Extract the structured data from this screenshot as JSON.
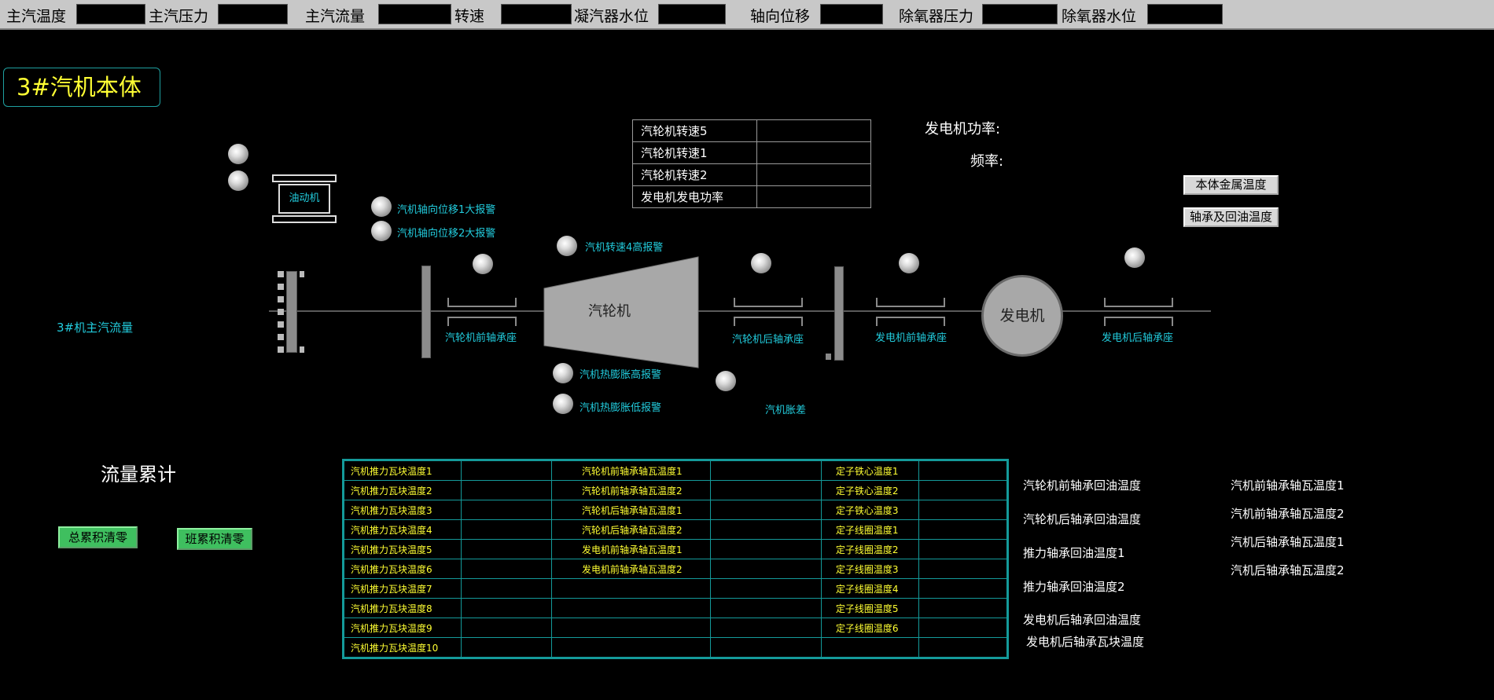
{
  "header": {
    "labels": [
      "主汽温度",
      "主汽压力",
      "主汽流量",
      "转速",
      "凝汽器水位",
      "轴向位移",
      "除氧器压力",
      "除氧器水位"
    ]
  },
  "page_title": "3#汽机本体",
  "equipment": {
    "oil_pump": "油动机",
    "turbine": "汽轮机",
    "generator": "发电机",
    "main_steam_flow": "3#机主汽流量",
    "bearings": [
      "汽轮机前轴承座",
      "汽轮机后轴承座",
      "发电机前轴承座",
      "发电机后轴承座"
    ],
    "differential_expansion": "汽机胀差"
  },
  "alarms": {
    "axial1": "汽机轴向位移1大报警",
    "axial2": "汽机轴向位移2大报警",
    "speed4": "汽机转速4高报警",
    "exp_high": "汽机热膨胀高报警",
    "exp_low": "汽机热膨胀低报警"
  },
  "speed_table": [
    {
      "label": "汽轮机转速5",
      "value": ""
    },
    {
      "label": "汽轮机转速1",
      "value": ""
    },
    {
      "label": "汽轮机转速2",
      "value": ""
    },
    {
      "label": "发电机发电功率",
      "value": ""
    }
  ],
  "generator_power_label": "发电机功率:",
  "frequency_label": "频率:",
  "buttons": {
    "metal_temp": "本体金属温度",
    "bearing_oil_temp": "轴承及回油温度",
    "total_reset": "总累积清零",
    "shift_reset": "班累积清零"
  },
  "flow_total_label": "流量累计",
  "temp_table": {
    "col1": [
      "汽机推力瓦块温度1",
      "汽机推力瓦块温度2",
      "汽机推力瓦块温度3",
      "汽机推力瓦块温度4",
      "汽机推力瓦块温度5",
      "汽机推力瓦块温度6",
      "汽机推力瓦块温度7",
      "汽机推力瓦块温度8",
      "汽机推力瓦块温度9",
      "汽机推力瓦块温度10"
    ],
    "col2": [
      "汽轮机前轴承轴瓦温度1",
      "汽轮机前轴承轴瓦温度2",
      "汽轮机后轴承轴瓦温度1",
      "汽轮机后轴承轴瓦温度2",
      "发电机前轴承轴瓦温度1",
      "发电机前轴承轴瓦温度2",
      "",
      "",
      "",
      ""
    ],
    "col3": [
      "定子铁心温度1",
      "定子铁心温度2",
      "定子铁心温度3",
      "定子线圈温度1",
      "定子线圈温度2",
      "定子线圈温度3",
      "定子线圈温度4",
      "定子线圈温度5",
      "定子线圈温度6",
      ""
    ]
  },
  "right_labels_1": [
    "汽轮机前轴承回油温度",
    "汽轮机后轴承回油温度",
    "推力轴承回油温度1",
    "推力轴承回油温度2",
    "发电机后轴承回油温度",
    "发电机后轴承瓦块温度"
  ],
  "right_labels_2": [
    "汽机前轴承轴瓦温度1",
    "汽机前轴承轴瓦温度2",
    "汽机后轴承轴瓦温度1",
    "汽机后轴承轴瓦温度2"
  ]
}
